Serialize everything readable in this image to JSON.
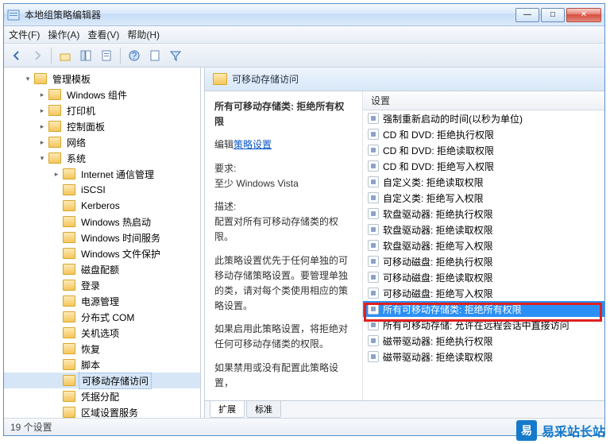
{
  "window": {
    "title": "本地组策略编辑器"
  },
  "menu": {
    "file": "文件(F)",
    "action": "操作(A)",
    "view": "查看(V)",
    "help": "帮助(H)"
  },
  "tree": {
    "root": "管理模板",
    "items_top": [
      "Windows 组件",
      "打印机",
      "控制面板",
      "网络"
    ],
    "system": "系统",
    "system_items": [
      "Internet 通信管理",
      "iSCSI",
      "Kerberos",
      "Windows 热启动",
      "Windows 时间服务",
      "Windows 文件保护",
      "磁盘配额",
      "登录",
      "电源管理",
      "分布式 COM",
      "关机选项",
      "恢复",
      "脚本",
      "可移动存储访问",
      "凭据分配",
      "区域设置服务"
    ],
    "selected_index": 13
  },
  "detail": {
    "header": "可移动存储访问",
    "policy_title": "所有可移动存储类: 拒绝所有权限",
    "edit_label": "编辑",
    "edit_link": "策略设置",
    "req_label": "要求:",
    "req_value": "至少 Windows Vista",
    "desc_label": "描述:",
    "desc_p1": "配置对所有可移动存储类的权限。",
    "desc_p2": "此策略设置优先于任何单独的可移动存储策略设置。要管理单独的类，请对每个类使用相应的策略设置。",
    "desc_p3": "如果启用此策略设置，将拒绝对任何可移动存储类的权限。",
    "desc_p4": "如果禁用或没有配置此策略设置，"
  },
  "list": {
    "header": "设置",
    "items": [
      "强制重新启动的时间(以秒为单位)",
      "CD 和 DVD: 拒绝执行权限",
      "CD 和 DVD: 拒绝读取权限",
      "CD 和 DVD: 拒绝写入权限",
      "自定义类: 拒绝读取权限",
      "自定义类: 拒绝写入权限",
      "软盘驱动器: 拒绝执行权限",
      "软盘驱动器: 拒绝读取权限",
      "软盘驱动器: 拒绝写入权限",
      "可移动磁盘: 拒绝执行权限",
      "可移动磁盘: 拒绝读取权限",
      "可移动磁盘: 拒绝写入权限",
      "所有可移动存储类: 拒绝所有权限",
      "所有可移动存储: 允许在远程会话中直接访问",
      "磁带驱动器: 拒绝执行权限",
      "磁带驱动器: 拒绝读取权限"
    ],
    "selected_index": 12
  },
  "tabs": {
    "extended": "扩展",
    "standard": "标准"
  },
  "status": "19 个设置",
  "watermark": {
    "badge": "易",
    "text": "易采站长站"
  }
}
